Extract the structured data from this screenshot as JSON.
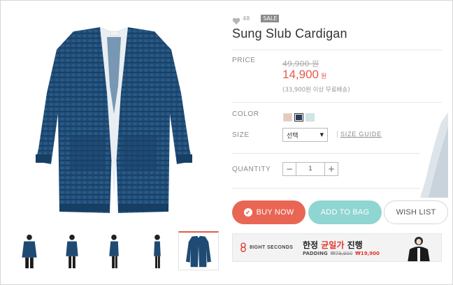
{
  "product": {
    "like_count": "48",
    "badge": "SALE",
    "title": "Sung Slub Cardigan"
  },
  "price": {
    "label": "PRICE",
    "original": "49,900 원",
    "current": "14,900",
    "currency": "원",
    "shipping_note": "(33,900원 이상 무료배송)"
  },
  "color": {
    "label": "COLOR",
    "swatches": [
      "#e8c9bc",
      "#2a3d5c",
      "#cfe6e8"
    ],
    "selected_index": 1
  },
  "size": {
    "label": "SIZE",
    "select_value": "선택",
    "guide_link": "SIZE GUIDE"
  },
  "quantity": {
    "label": "QUANTITY",
    "minus": "−",
    "value": "1",
    "plus": "+"
  },
  "buttons": {
    "buy_now": "BUY NOW",
    "add_to_bag": "ADD TO BAG",
    "wish_list": "WISH LIST"
  },
  "banner": {
    "brand": "8IGHT SECONDS",
    "headline_pre": "한정 ",
    "headline_highlight": "균일가",
    "headline_post": " 진행",
    "sub_label": "PADDING",
    "sub_old": "₩79,900",
    "sub_new": "₩19,900"
  },
  "colors": {
    "accent_red": "#e96655",
    "accent_teal": "#8fd5d1",
    "cardigan_navy": "#1f4a73"
  },
  "thumbnails": [
    "front-model",
    "front-model-2",
    "side-model",
    "side-model-2",
    "flat-product"
  ],
  "thumbnail_active_index": 4
}
